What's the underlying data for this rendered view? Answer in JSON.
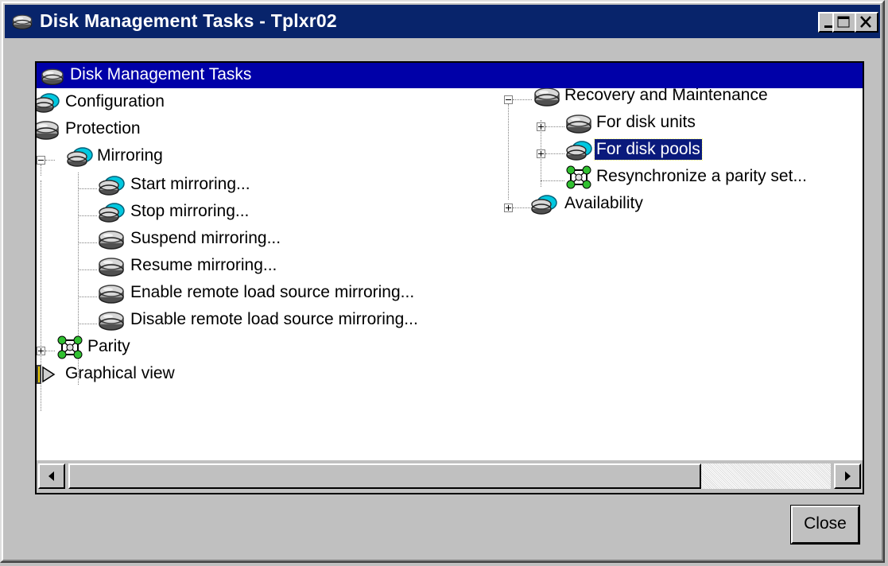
{
  "window": {
    "title": "Disk Management Tasks - Tplxr02",
    "minimize_label": "minimize",
    "maximize_label": "maximize",
    "close_label": "close"
  },
  "panel": {
    "header": "Disk Management Tasks"
  },
  "tree_left": {
    "configuration": "Configuration",
    "protection": "Protection",
    "mirroring": "Mirroring",
    "mirroring_children": [
      "Start mirroring...",
      "Stop mirroring...",
      "Suspend mirroring...",
      "Resume mirroring...",
      "Enable remote load source mirroring...",
      "Disable remote load source mirroring..."
    ],
    "parity": "Parity",
    "graphical_view": "Graphical view"
  },
  "tree_right": {
    "recovery": "Recovery and Maintenance",
    "recovery_children": [
      "For disk units",
      "For disk pools",
      "Resynchronize a parity set..."
    ],
    "availability": "Availability",
    "selected": "For disk pools"
  },
  "buttons": {
    "close": "Close"
  },
  "colors": {
    "titlebar": "#08246b",
    "panel_header": "#0000a8",
    "selection": "#0a1a7c",
    "face": "#c0c0c0"
  }
}
